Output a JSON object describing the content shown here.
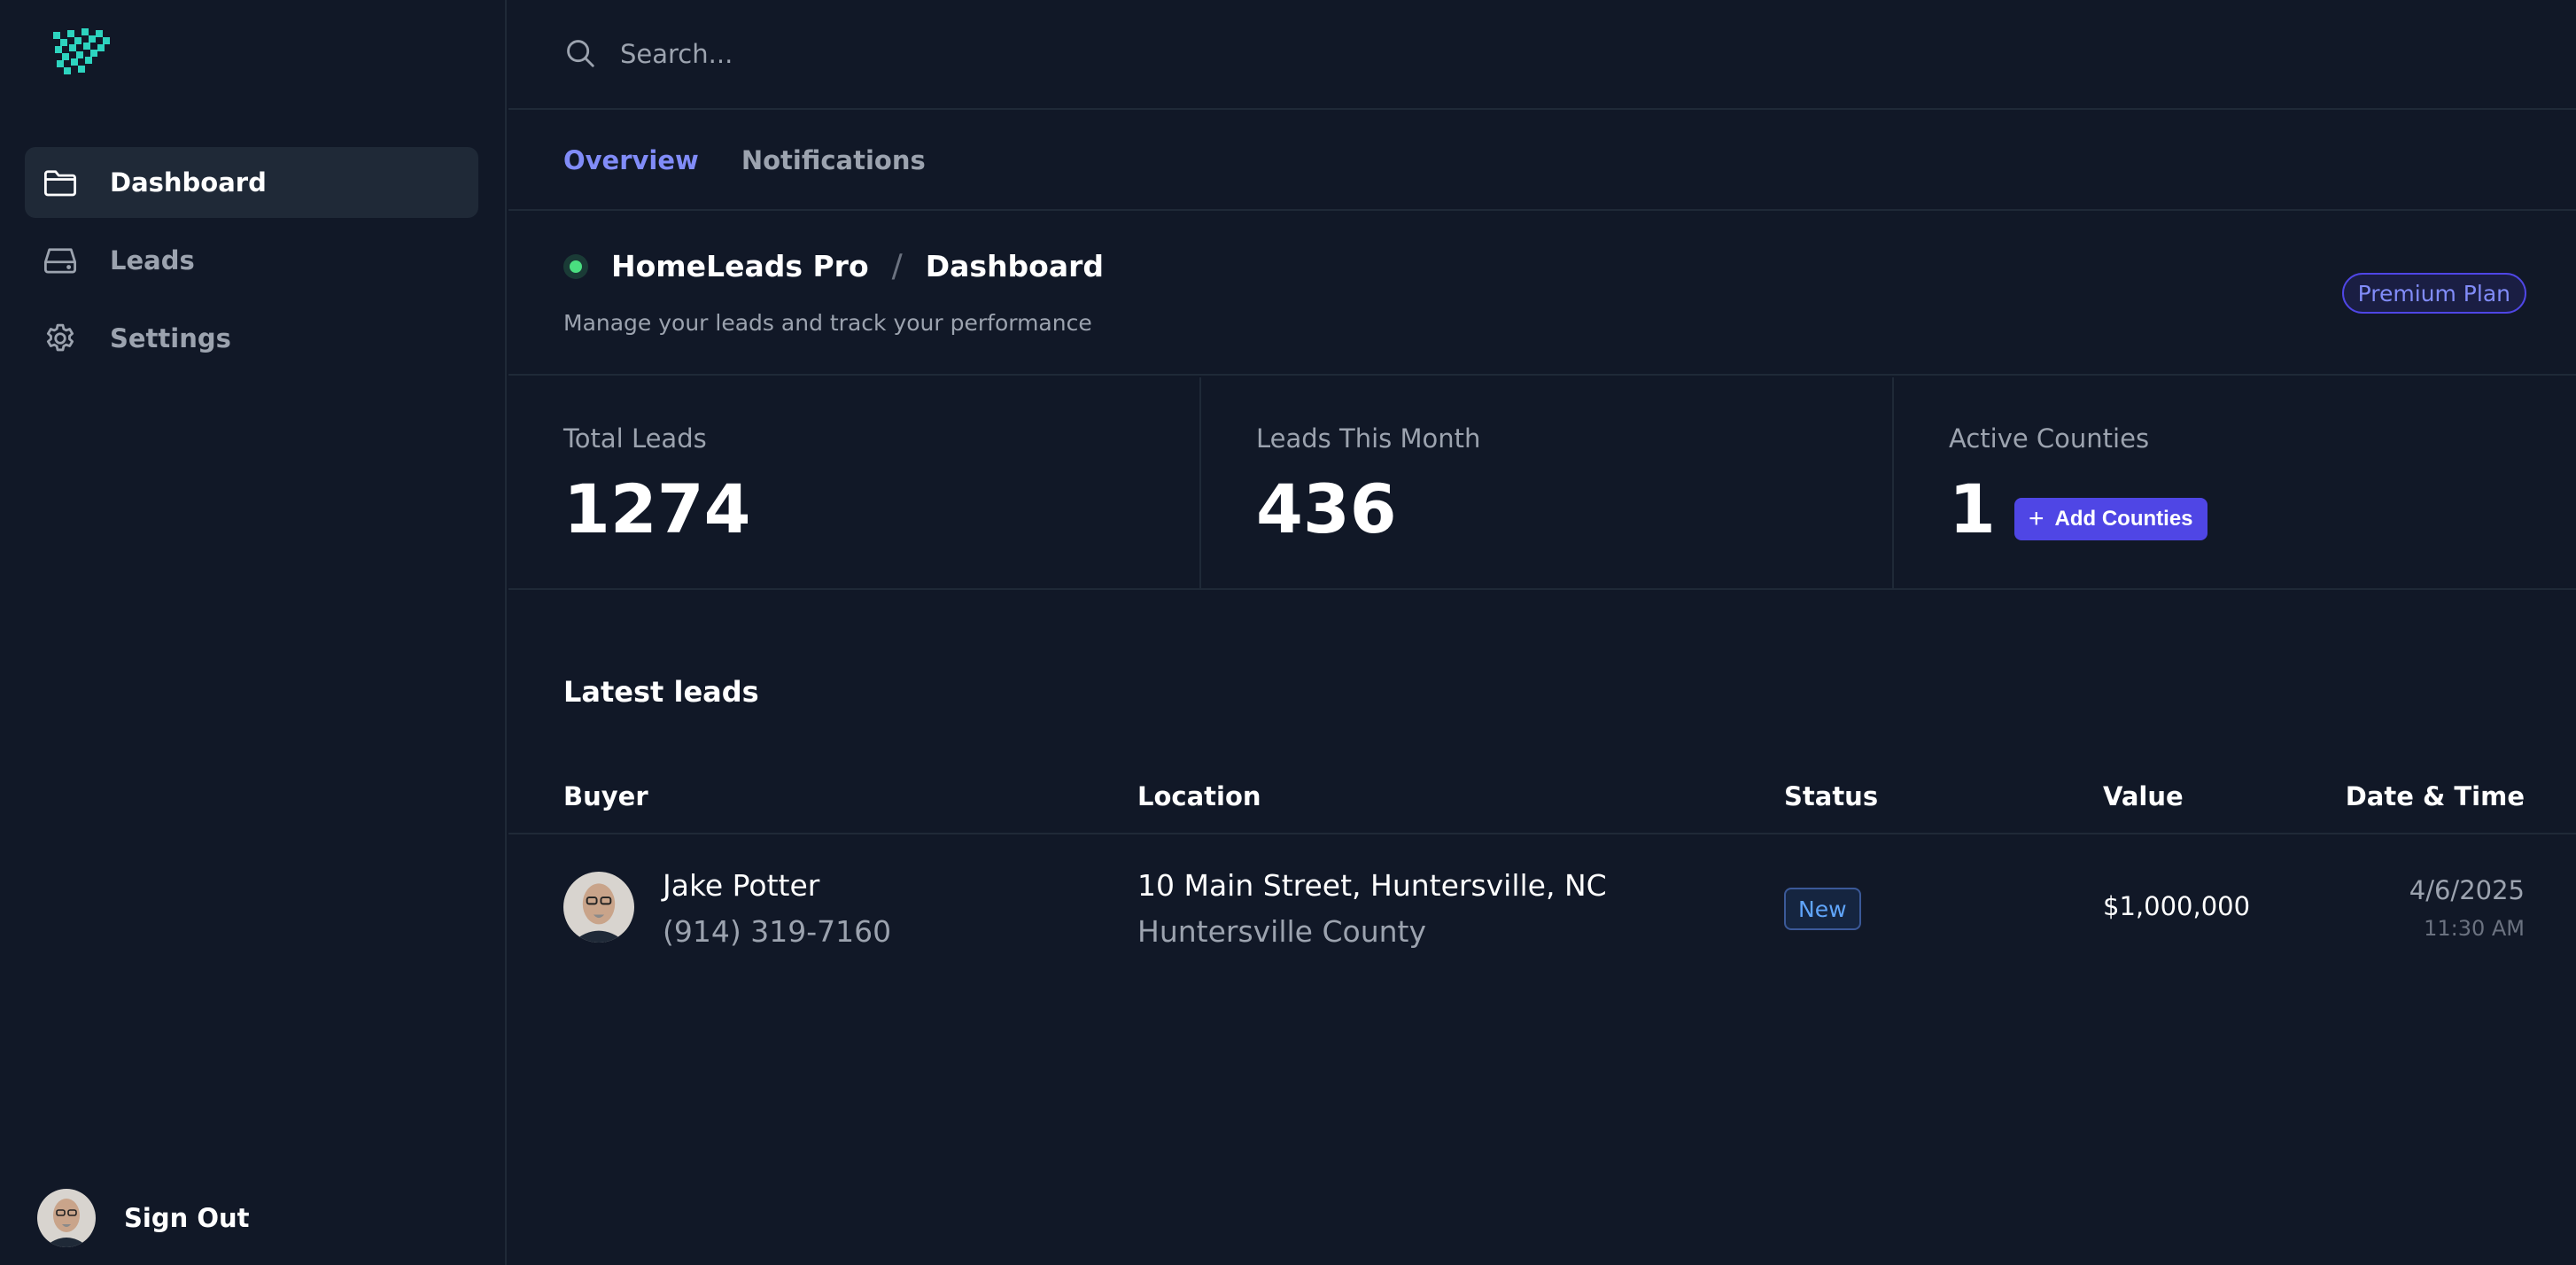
{
  "sidebar": {
    "logo_icon": "checkered-flag-logo",
    "items": [
      {
        "label": "Dashboard",
        "icon": "folder-icon",
        "active": true
      },
      {
        "label": "Leads",
        "icon": "hard-drive-icon",
        "active": false
      },
      {
        "label": "Settings",
        "icon": "gear-icon",
        "active": false
      }
    ],
    "signout_label": "Sign Out"
  },
  "search": {
    "placeholder": "Search..."
  },
  "tabs": [
    {
      "label": "Overview",
      "active": true
    },
    {
      "label": "Notifications",
      "active": false
    }
  ],
  "header": {
    "app_name": "HomeLeads Pro",
    "separator": "/",
    "page": "Dashboard",
    "subtitle": "Manage your leads and track your performance",
    "plan_badge": "Premium Plan"
  },
  "stats": [
    {
      "label": "Total Leads",
      "value": "1274"
    },
    {
      "label": "Leads This Month",
      "value": "436"
    },
    {
      "label": "Active Counties",
      "value": "1",
      "button": "Add Counties"
    }
  ],
  "latest": {
    "title": "Latest leads",
    "columns": [
      "Buyer",
      "Location",
      "Status",
      "Value",
      "Date & Time"
    ],
    "rows": [
      {
        "name": "Jake Potter",
        "phone": "(914) 319-7160",
        "address": "10 Main Street, Huntersville, NC",
        "county": "Huntersville County",
        "status": "New",
        "value": "$1,000,000",
        "date": "4/6/2025",
        "time": "11:30 AM"
      }
    ]
  },
  "colors": {
    "background": "#111827",
    "accent": "#818cf8",
    "button": "#4f46e5",
    "logo": "#2dd4bf",
    "status_online": "#4ade80"
  }
}
